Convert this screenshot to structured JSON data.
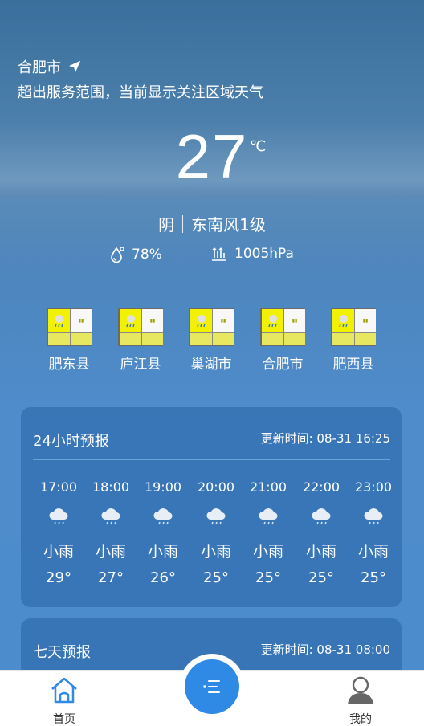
{
  "location": {
    "city": "合肥市",
    "notice": "超出服务范围，当前显示关注区域天气",
    "icon": "navigation-arrow-icon"
  },
  "current": {
    "temperature": "27",
    "unit": "℃",
    "weather": "阴",
    "wind": "东南风1级",
    "humidity": "78%",
    "pressure": "1005hPa"
  },
  "warnings": [
    {
      "name": "肥东县"
    },
    {
      "name": "庐江县"
    },
    {
      "name": "巢湖市"
    },
    {
      "name": "合肥市"
    },
    {
      "name": "肥西县"
    }
  ],
  "hourly": {
    "title": "24小时预报",
    "updated": "更新时间: 08-31 16:25",
    "items": [
      {
        "time": "17:00",
        "desc": "小雨",
        "temp": "29°",
        "icon": "light-rain-icon"
      },
      {
        "time": "18:00",
        "desc": "小雨",
        "temp": "27°",
        "icon": "light-rain-icon"
      },
      {
        "time": "19:00",
        "desc": "小雨",
        "temp": "26°",
        "icon": "light-rain-icon"
      },
      {
        "time": "20:00",
        "desc": "小雨",
        "temp": "25°",
        "icon": "light-rain-icon"
      },
      {
        "time": "21:00",
        "desc": "小雨",
        "temp": "25°",
        "icon": "light-rain-icon"
      },
      {
        "time": "22:00",
        "desc": "小雨",
        "temp": "25°",
        "icon": "light-rain-icon"
      },
      {
        "time": "23:00",
        "desc": "小雨",
        "temp": "25°",
        "icon": "light-rain-icon"
      }
    ]
  },
  "weekly": {
    "title": "七天预报",
    "updated": "更新时间: 08-31 08:00"
  },
  "tabbar": {
    "home_label": "首页",
    "mine_label": "我的",
    "accent": "#2f8ae6"
  }
}
